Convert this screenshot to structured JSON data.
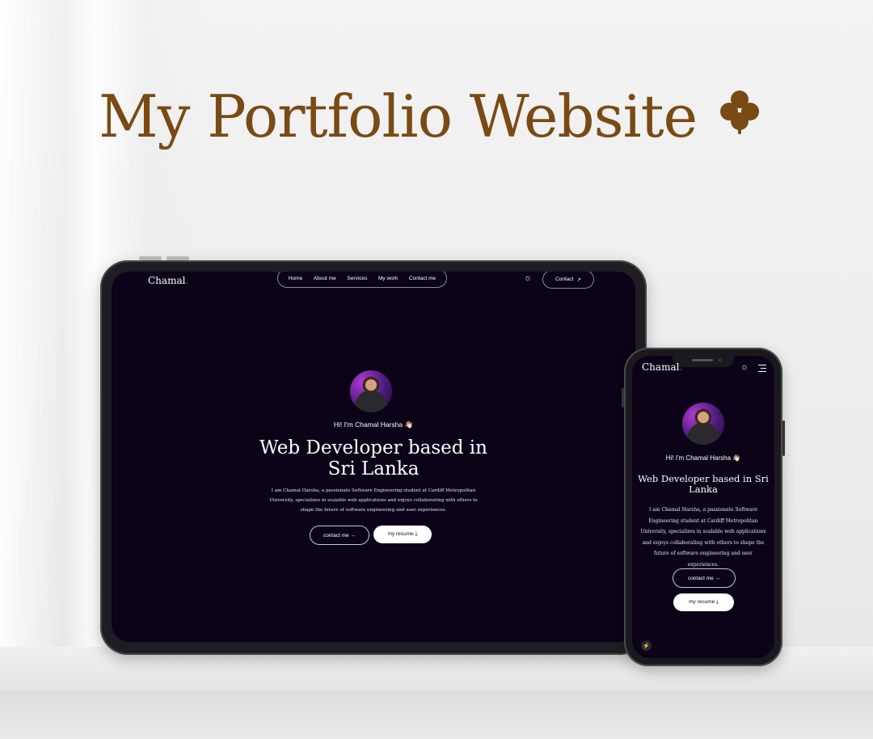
{
  "heading": "My Portfolio Website",
  "colors": {
    "heading": "#7a4a14",
    "screen_bg": "#0c0318",
    "brand_dot": "#e4453a"
  },
  "site": {
    "brand": "Chamal",
    "brand_dot": ".",
    "nav": [
      "Home",
      "About me",
      "Services",
      "My work",
      "Contact me"
    ],
    "contact_label": "Contact",
    "contact_icon": "arrow-up-right-icon",
    "theme_icon": "sun-icon",
    "menu_icon": "hamburger-icon",
    "greeting": "Hi! I'm Chamal Harsha 👋🏻",
    "headline": "Web Developer based in Sri Lanka",
    "tablet_headline_lines": [
      "Web Developer based in",
      "Sri Lanka"
    ],
    "phone_headline_lines": [
      "Web Developer based in Sri",
      "Lanka"
    ],
    "description": "I am Chamal Harsha, a passionate Software Engineering student at Cardiff Metropolitan University, specializes in scalable web applications and enjoys collaborating with others to shape the future of software engineering and user experiences.",
    "btn_contact": "contact me →",
    "btn_resume": "my resume ⤓"
  }
}
